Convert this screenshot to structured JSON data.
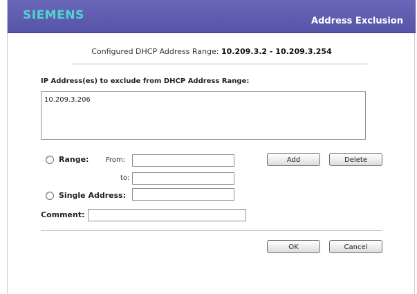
{
  "header": {
    "logo": "SIEMENS",
    "title": "Address Exclusion"
  },
  "range": {
    "label": "Configured DHCP Address Range:",
    "value": "10.209.3.2 - 10.209.3.254"
  },
  "exclusions": {
    "label": "IP Address(es) to exclude from DHCP Address Range:",
    "items": [
      "10.209.3.206"
    ]
  },
  "form": {
    "range_label": "Range:",
    "from_label": "From:",
    "to_label": "to:",
    "single_label": "Single Address:",
    "comment_label": "Comment:",
    "from_value": "",
    "to_value": "",
    "single_value": "",
    "comment_value": ""
  },
  "buttons": {
    "add": "Add",
    "delete": "Delete",
    "ok": "OK",
    "cancel": "Cancel"
  },
  "colors": {
    "header_bg": "#5f5cb0",
    "logo": "#4fd6d0"
  }
}
